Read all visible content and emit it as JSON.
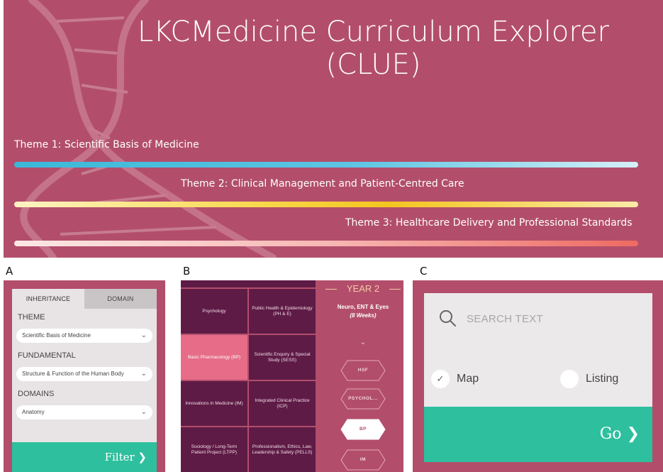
{
  "hero": {
    "title_line1": "LKCMedicine Curriculum Explorer",
    "title_line2": "(CLUE)",
    "themes": [
      {
        "label": "Theme 1: Scientific Basis of Medicine",
        "color": "#5ec5e3"
      },
      {
        "label": "Theme 2: Clinical Management and Patient-Centred Care",
        "color": "#f3c51f"
      },
      {
        "label": "Theme 3: Healthcare Delivery and Professional Standards",
        "color": "#ee6a62"
      }
    ]
  },
  "panels": {
    "a": "A",
    "b": "B",
    "c": "C"
  },
  "panel_a": {
    "tabs": [
      "INHERITANCE",
      "DOMAIN"
    ],
    "theme_label": "THEME",
    "theme_value": "Scientific Basis of Medicine",
    "fundamental_label": "FUNDAMENTAL",
    "fundamental_value": "Structure & Function of the Human Body",
    "domains_label": "DOMAINS",
    "domains_value": "Anatomy",
    "filter_label": "Filter"
  },
  "panel_b": {
    "cells": [
      "Psychology",
      "Public Health & Epidemiology (PH & E)",
      "Basic Pharmacology (BP)",
      "Scientific Enquiry & Special Study (SESS)",
      "Innovations in Medicine (IM)",
      "Integrated Clinical Practice (ICP)",
      "Sociology / Long-Term Patient Project (LTPP)",
      "Professionalism, Ethics, Law, Leadership & Safety (PELLS)"
    ],
    "year_title": "YEAR 2",
    "year_desc_line1": "Neuro, ENT & Eyes",
    "year_desc_line2": "(8 Weeks)",
    "hex_items": [
      "HSF",
      "PSYCHOL...",
      "BP",
      "IM"
    ]
  },
  "panel_c": {
    "search_placeholder": "SEARCH TEXT",
    "option_map": "Map",
    "option_listing": "Listing",
    "go_label": "Go"
  },
  "colors": {
    "background": "#b24e6b",
    "accent": "#2ebf9e",
    "cell": "#5e1b46",
    "cell_highlight": "#e66c88"
  }
}
